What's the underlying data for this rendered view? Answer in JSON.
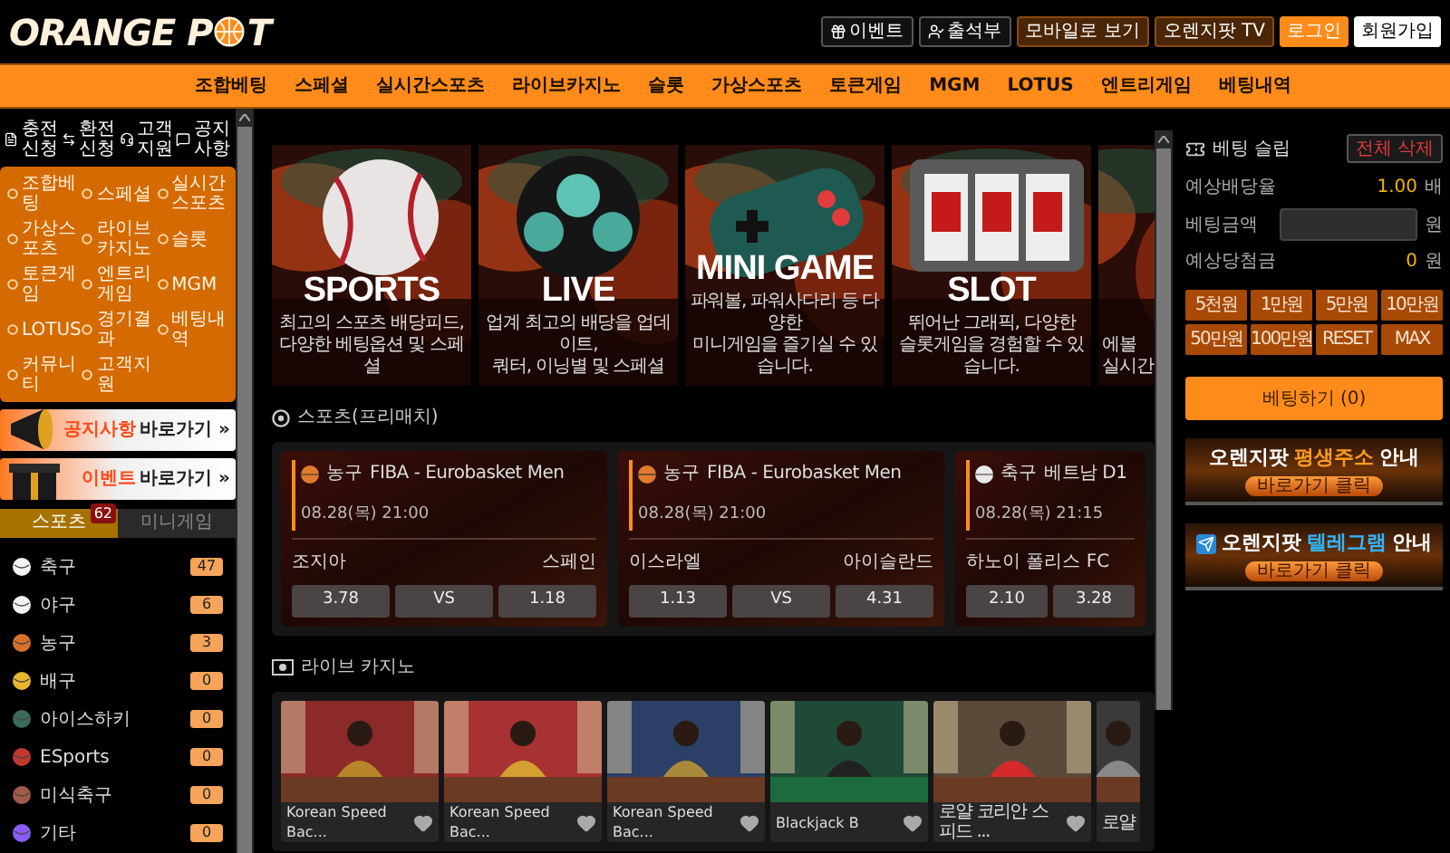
{
  "header": {
    "logo": [
      "ORANGE P",
      "T"
    ],
    "buttons": [
      {
        "label": "이벤트",
        "kind": "outline"
      },
      {
        "label": "출석부",
        "kind": "outline"
      },
      {
        "label": "모바일로 보기",
        "kind": "brown"
      },
      {
        "label": "오렌지팟 TV",
        "kind": "brown"
      },
      {
        "label": "로그인",
        "kind": "primary"
      },
      {
        "label": "회원가입",
        "kind": "light"
      }
    ]
  },
  "nav": [
    "조합베팅",
    "스페셜",
    "실시간스포츠",
    "라이브카지노",
    "슬롯",
    "가상스포츠",
    "토큰게임",
    "MGM",
    "LOTUS",
    "엔트리게임",
    "베팅내역"
  ],
  "sidebar": {
    "quick_links": [
      "충전신청",
      "환전신청",
      "고객지원",
      "공지사항"
    ],
    "menu": [
      "조합베팅",
      "스페셜",
      "실시간스포츠",
      "가상스포츠",
      "라이브카지노",
      "슬롯",
      "토큰게임",
      "엔트리게임",
      "MGM",
      "LOTUS",
      "경기결과",
      "베팅내역",
      "커뮤니티",
      "고객지원"
    ],
    "banners": [
      {
        "kind": "notice",
        "highlight": "공지사항",
        "rest": "바로가기 »"
      },
      {
        "kind": "event",
        "highlight": "이벤트",
        "rest": "바로가기 »"
      }
    ],
    "tabs": [
      {
        "label": "스포츠",
        "selected": true,
        "badge": "62"
      },
      {
        "label": "미니게임",
        "selected": false
      }
    ],
    "sports": [
      {
        "name": "축구",
        "count": "47"
      },
      {
        "name": "야구",
        "count": "6"
      },
      {
        "name": "농구",
        "count": "3"
      },
      {
        "name": "배구",
        "count": "0"
      },
      {
        "name": "아이스하키",
        "count": "0"
      },
      {
        "name": "ESports",
        "count": "0"
      },
      {
        "name": "미식축구",
        "count": "0"
      },
      {
        "name": "기타",
        "count": "0"
      }
    ]
  },
  "main": {
    "promos": [
      {
        "kind": "baseball",
        "title": "SPORTS",
        "desc": [
          "최고의 스포츠 배당피드,",
          "다양한 베팅옵션 및 스페셜"
        ]
      },
      {
        "kind": "soccer",
        "title": "LIVE",
        "desc": [
          "업계 최고의 배당을 업데이트,",
          "쿼터, 이닝별 및 스페셜"
        ]
      },
      {
        "kind": "gamepad",
        "title": "MINI GAME",
        "desc": [
          "파워볼, 파워사다리 등 다양한",
          "미니게임을 즐기실 수 있습니다."
        ]
      },
      {
        "kind": "slot",
        "title": "SLOT",
        "desc": [
          "뛰어난 그래픽, 다양한",
          "슬롯게임을 경험할 수 있습니다."
        ]
      },
      {
        "kind": "cards",
        "desc": [
          "에볼",
          "실시간"
        ]
      }
    ],
    "sports_title": "스포츠(프리매치)",
    "matches": [
      {
        "kind": "basketball",
        "sport": "농구",
        "league": "FIBA - Eurobasket Men",
        "time": "08.28(목) 21:00",
        "home": "조지아",
        "away": "스페인",
        "odds": [
          "3.78",
          "VS",
          "1.18"
        ]
      },
      {
        "kind": "basketball",
        "sport": "농구",
        "league": "FIBA - Eurobasket Men",
        "time": "08.28(목) 21:00",
        "home": "이스라엘",
        "away": "아이슬란드",
        "odds": [
          "1.13",
          "VS",
          "4.31"
        ]
      },
      {
        "kind": "soccer",
        "sport": "축구",
        "league": "베트남 D1",
        "time": "08.28(목) 21:15",
        "home": "하노이 폴리스 FC",
        "odds": [
          "2.10",
          "3.28"
        ]
      }
    ],
    "casino_title": "라이브 카지노",
    "casino": [
      {
        "name": "Korean Speed Bac..."
      },
      {
        "name": "Korean Speed Bac..."
      },
      {
        "name": "Korean Speed Bac..."
      },
      {
        "name": "Blackjack B"
      },
      {
        "name": "로얄 코리안 스피드 ..."
      },
      {
        "name": "로얄"
      }
    ]
  },
  "bet_slip": {
    "title": "베팅 슬립",
    "clear": "전체 삭제",
    "rows": [
      {
        "kind": "value",
        "label": "예상배당율",
        "value": "1.00",
        "unit": "배"
      },
      {
        "kind": "input",
        "label": "베팅금액",
        "unit": "원"
      },
      {
        "kind": "value",
        "label": "예상당첨금",
        "value": "0",
        "unit": "원"
      }
    ],
    "chips": [
      "5천원",
      "1만원",
      "5만원",
      "10만원",
      "50만원",
      "100만원",
      "RESET",
      "MAX"
    ],
    "submit": "베팅하기 (0)"
  },
  "banners": [
    {
      "kind": "address",
      "prefix": "오렌지팟",
      "highlight": "평생주소",
      "suffix": "안내",
      "color": "#ff9a1f",
      "button": "바로가기 클릭"
    },
    {
      "kind": "telegram",
      "prefix": "오렌지팟",
      "highlight": "텔레그램",
      "suffix": "안내",
      "color": "#33b5ff",
      "button": "바로가기 클릭"
    }
  ]
}
